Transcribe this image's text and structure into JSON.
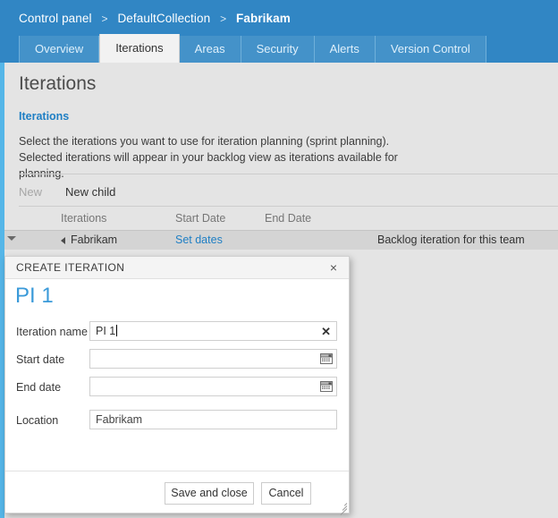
{
  "header": {
    "breadcrumb": {
      "items": [
        "Control panel",
        "DefaultCollection",
        "Fabrikam"
      ],
      "separator": ">"
    },
    "tabs": [
      {
        "label": "Overview",
        "active": false
      },
      {
        "label": "Iterations",
        "active": true
      },
      {
        "label": "Areas",
        "active": false
      },
      {
        "label": "Security",
        "active": false
      },
      {
        "label": "Alerts",
        "active": false
      },
      {
        "label": "Version Control",
        "active": false
      }
    ]
  },
  "page": {
    "title": "Iterations",
    "section_title": "Iterations",
    "section_description": "Select the iterations you want to use for iteration planning (sprint planning). Selected iterations will appear in your backlog view as iterations available for planning."
  },
  "toolbar": {
    "new_label": "New",
    "new_child_label": "New child"
  },
  "table": {
    "columns": [
      "Iterations",
      "Start Date",
      "End Date"
    ],
    "rows": [
      {
        "name": "Fabrikam",
        "dates_link": "Set dates",
        "description": "Backlog iteration for this team"
      }
    ]
  },
  "dialog": {
    "title": "CREATE ITERATION",
    "close_label": "×",
    "heading": "PI 1",
    "fields": [
      {
        "label": "Iteration name",
        "value": "PI 1",
        "type": "text-clear"
      },
      {
        "label": "Start date",
        "value": "",
        "type": "date"
      },
      {
        "label": "End date",
        "value": "",
        "type": "date"
      },
      {
        "label": "Location",
        "value": "Fabrikam",
        "type": "text"
      }
    ],
    "clear_label": "✕",
    "buttons": {
      "save_label": "Save and close",
      "cancel_label": "Cancel"
    }
  },
  "colors": {
    "header_blue": "#3186c4",
    "tab_blue": "#4492c9",
    "accent_stripe": "#55b6e8",
    "link_blue": "#1f7fc4",
    "dialog_heading_blue": "#3a9ad9",
    "content_bg": "#e4e4e4"
  }
}
